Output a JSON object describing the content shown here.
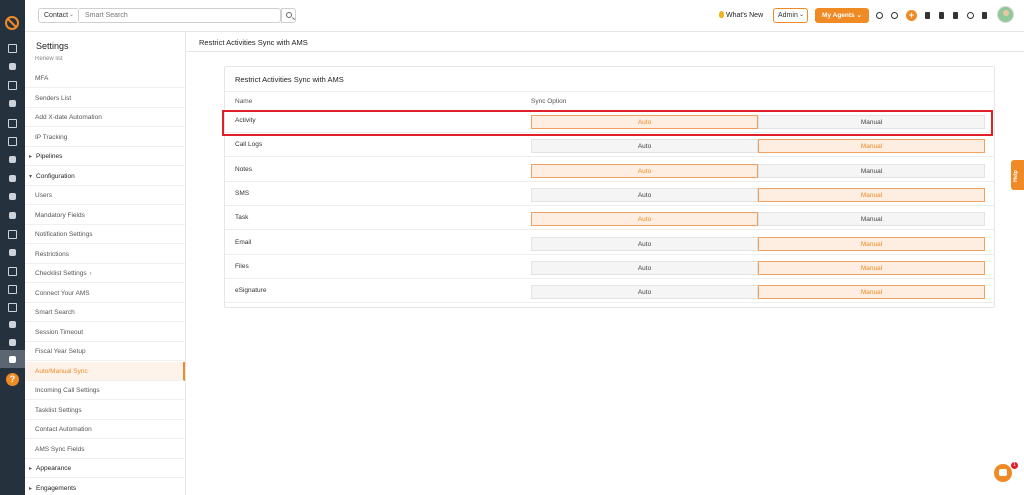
{
  "topbar": {
    "contact_label": "Contact",
    "search_placeholder": "Smart Search",
    "whats_new": "What's New",
    "admin_label": "Admin",
    "agents_label": "My Agents",
    "plus_label": "+"
  },
  "sidebar": {
    "title": "Settings",
    "cut_item": "Renew list",
    "items": [
      {
        "label": "MFA",
        "type": "item"
      },
      {
        "label": "Senders List",
        "type": "item"
      },
      {
        "label": "Add X-date Automation",
        "type": "item"
      },
      {
        "label": "IP Tracking",
        "type": "item"
      },
      {
        "label": "Pipelines",
        "type": "group"
      },
      {
        "label": "Configuration",
        "type": "group-open"
      },
      {
        "label": "Users",
        "type": "item"
      },
      {
        "label": "Mandatory Fields",
        "type": "item"
      },
      {
        "label": "Notification Settings",
        "type": "item"
      },
      {
        "label": "Restrictions",
        "type": "item"
      },
      {
        "label": "Checklist Settings",
        "type": "item"
      },
      {
        "label": "Connect Your AMS",
        "type": "item"
      },
      {
        "label": "Smart Search",
        "type": "item"
      },
      {
        "label": "Session Timeout",
        "type": "item"
      },
      {
        "label": "Fiscal Year Setup",
        "type": "item"
      },
      {
        "label": "Auto/Manual Sync",
        "type": "active"
      },
      {
        "label": "Incoming Call Settings",
        "type": "item"
      },
      {
        "label": "Tasklist Settings",
        "type": "item"
      },
      {
        "label": "Contact Automation",
        "type": "item"
      },
      {
        "label": "AMS Sync Fields",
        "type": "item"
      },
      {
        "label": "Appearance",
        "type": "group"
      },
      {
        "label": "Engagements",
        "type": "group"
      }
    ],
    "checklist_chevron": "›"
  },
  "main": {
    "page_title": "Restrict Activities Sync with AMS",
    "card_title": "Restrict Activities Sync with AMS",
    "col_name": "Name",
    "col_sync": "Sync Option",
    "auto_label": "Auto",
    "manual_label": "Manual",
    "rows": [
      {
        "name": "Activity",
        "selected": "auto"
      },
      {
        "name": "Call Logs",
        "selected": "manual"
      },
      {
        "name": "Notes",
        "selected": "auto"
      },
      {
        "name": "SMS",
        "selected": "manual"
      },
      {
        "name": "Task",
        "selected": "auto"
      },
      {
        "name": "Email",
        "selected": "manual"
      },
      {
        "name": "Files",
        "selected": "manual"
      },
      {
        "name": "eSignature",
        "selected": "manual"
      }
    ]
  },
  "help_tab": "Help",
  "chat_badge": "1",
  "colors": {
    "accent": "#f08a24",
    "rail": "#26313e",
    "highlight": "#e01f26"
  }
}
